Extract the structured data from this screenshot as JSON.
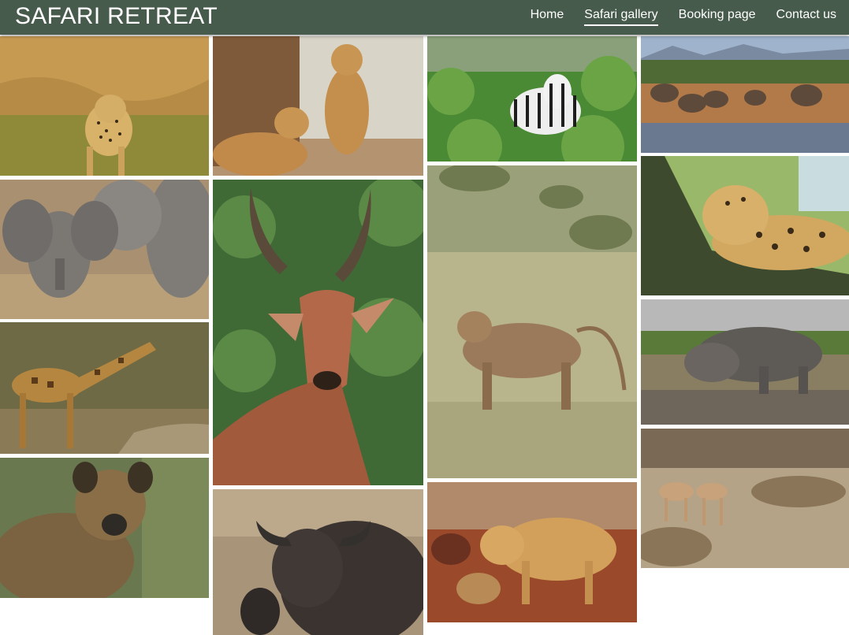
{
  "site": {
    "title": "SAFARI RETREAT",
    "colors": {
      "header_bg": "#475b4d",
      "header_text": "#ffffff",
      "page_bg": "#ffffff"
    }
  },
  "nav": {
    "items": [
      {
        "label": "Home",
        "active": false
      },
      {
        "label": "Safari gallery",
        "active": true
      },
      {
        "label": "Booking page",
        "active": false
      },
      {
        "label": "Contact us",
        "active": false
      }
    ]
  },
  "gallery": {
    "columns": [
      [
        "cheetah",
        "elephant calf",
        "giraffe",
        "hyena"
      ],
      [
        "lionesses",
        "impala",
        "buffalo"
      ],
      [
        "zebras",
        "baboon",
        "lion with cubs"
      ],
      [
        "elephant herd",
        "leopard",
        "rhinos",
        "antelopes"
      ]
    ]
  }
}
